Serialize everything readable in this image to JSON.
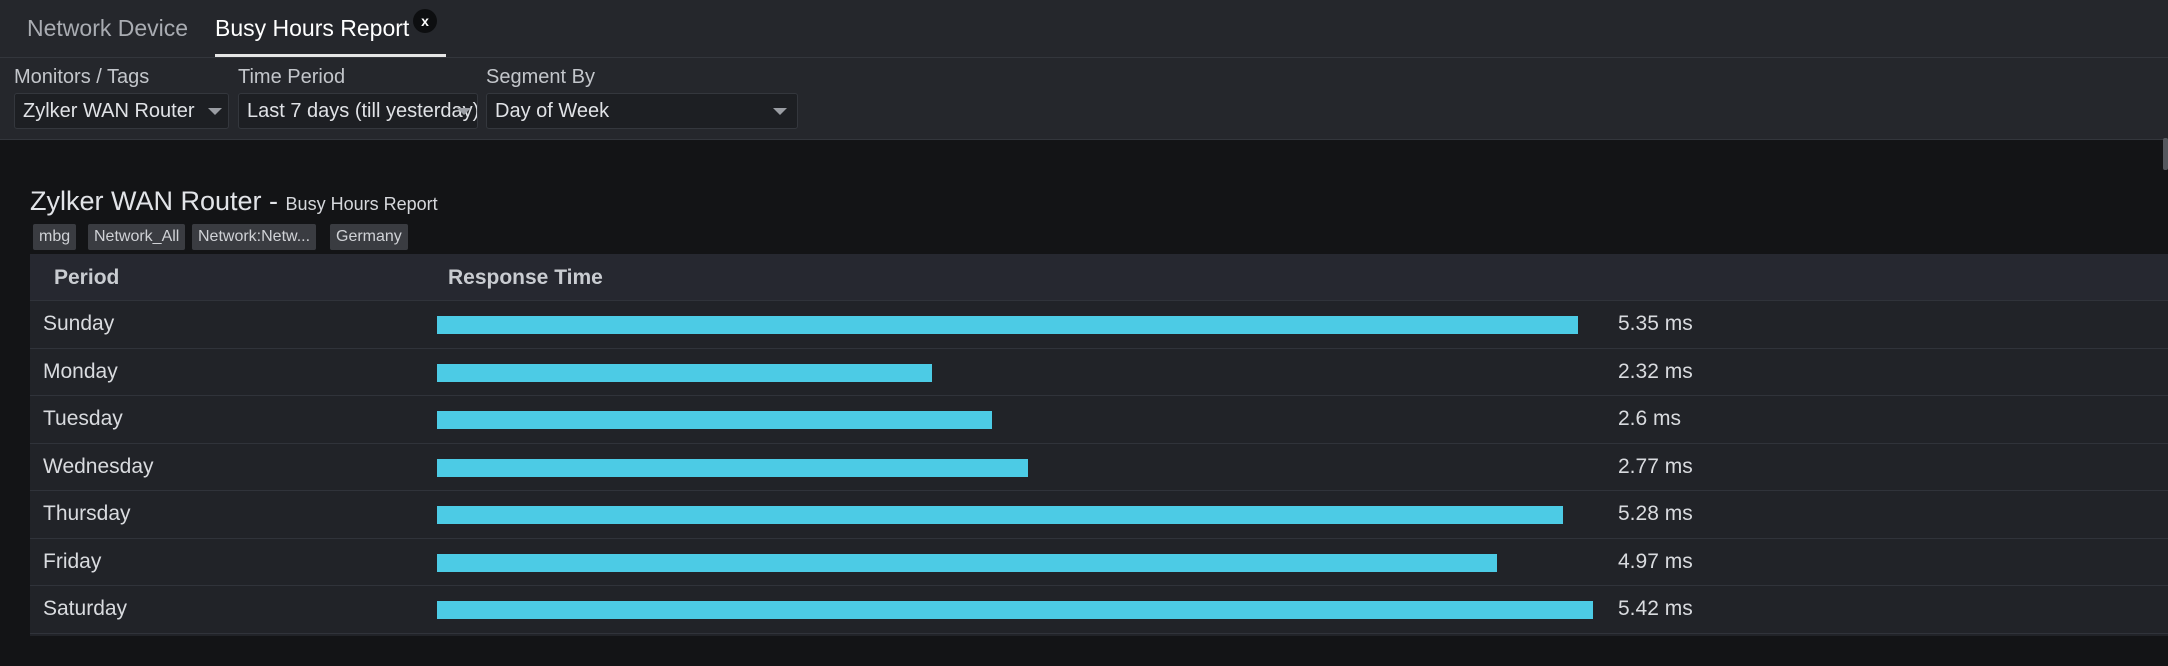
{
  "tabs": [
    {
      "label": "Network Device"
    },
    {
      "label": "Busy Hours Report",
      "close": "x"
    }
  ],
  "filters": {
    "monitors": {
      "label": "Monitors / Tags",
      "value": "Zylker WAN Router"
    },
    "time_period": {
      "label": "Time Period",
      "value": "Last 7 days (till yesterday)"
    },
    "segment_by": {
      "label": "Segment By",
      "value": "Day of Week"
    }
  },
  "report": {
    "title": "Zylker WAN Router -",
    "subtitle": "Busy Hours Report",
    "tags": [
      "mbg",
      "Network_All",
      "Network:Netw...",
      "Germany"
    ]
  },
  "table": {
    "headers": {
      "period": "Period",
      "response_time": "Response Time"
    },
    "rows": [
      {
        "period": "Sunday",
        "value": 5.35,
        "label": "5.35 ms"
      },
      {
        "period": "Monday",
        "value": 2.32,
        "label": "2.32 ms"
      },
      {
        "period": "Tuesday",
        "value": 2.6,
        "label": "2.6 ms"
      },
      {
        "period": "Wednesday",
        "value": 2.77,
        "label": "2.77 ms"
      },
      {
        "period": "Thursday",
        "value": 5.28,
        "label": "5.28 ms"
      },
      {
        "period": "Friday",
        "value": 4.97,
        "label": "4.97 ms"
      },
      {
        "period": "Saturday",
        "value": 5.42,
        "label": "5.42 ms"
      }
    ]
  },
  "colors": {
    "bar": "#4ccbe5",
    "background": "#131416",
    "panel": "#25272c"
  }
}
